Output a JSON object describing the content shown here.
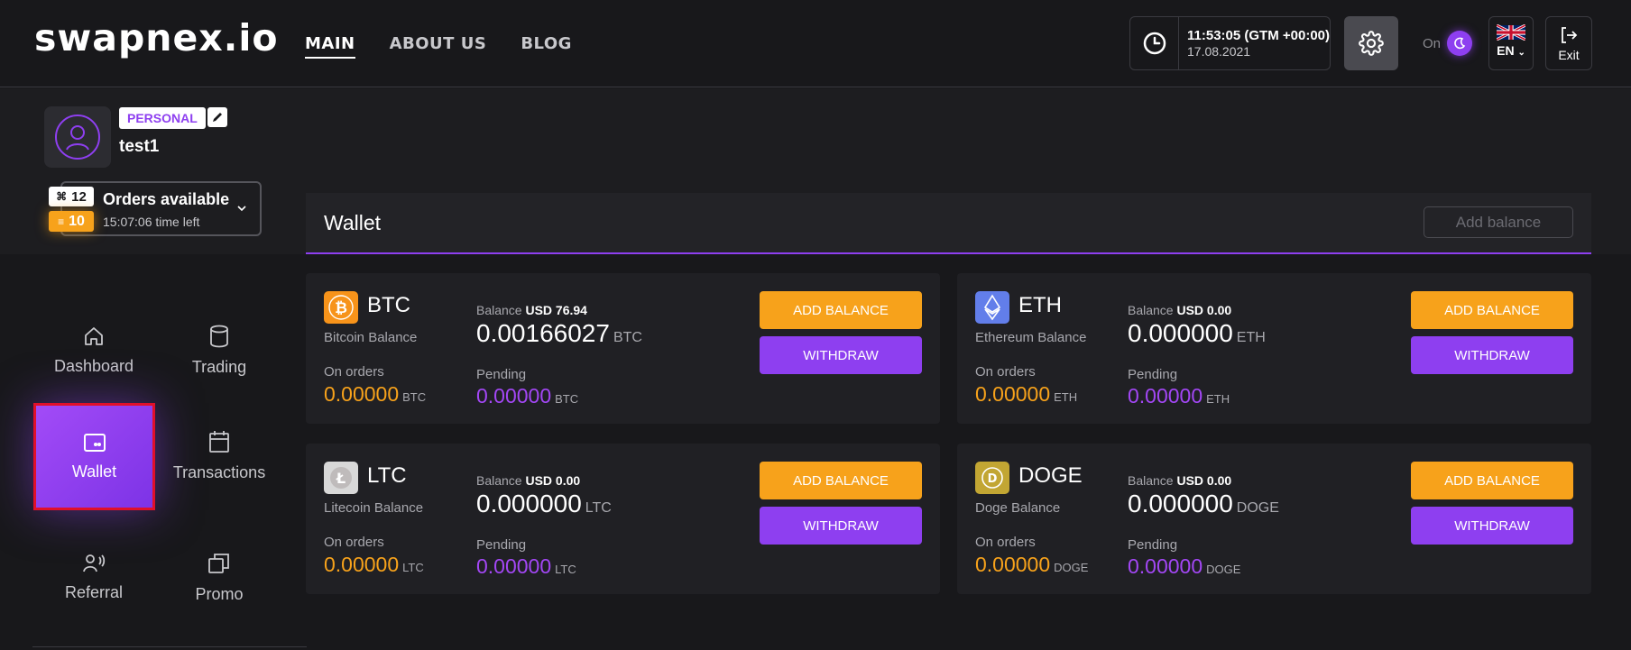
{
  "header": {
    "logo": "swapnex.io",
    "nav": [
      "MAIN",
      "ABOUT US",
      "BLOG"
    ],
    "clock": {
      "time": "11:53:05",
      "zone": "(GTM +00:00)",
      "date": "17.08.2021"
    },
    "theme_label": "On",
    "lang": "EN",
    "exit_label": "Exit"
  },
  "profile": {
    "badge": "PERSONAL",
    "username": "test1",
    "orders_badge_count": "12",
    "orders_badge_orange": "10",
    "orders_title": "Orders available",
    "orders_time": "15:07:06 time left"
  },
  "sidebar": [
    {
      "label": "Dashboard",
      "icon": "home-icon",
      "active": false
    },
    {
      "label": "Trading",
      "icon": "database-icon",
      "active": false
    },
    {
      "label": "Wallet",
      "icon": "wallet-icon",
      "active": true
    },
    {
      "label": "Transactions",
      "icon": "calendar-icon",
      "active": false
    },
    {
      "label": "Referral",
      "icon": "referral-icon",
      "active": false
    },
    {
      "label": "Promo",
      "icon": "promo-icon",
      "active": false
    }
  ],
  "wallet": {
    "title": "Wallet",
    "add_balance_top": "Add balance",
    "balance_label": "Balance",
    "on_orders_label": "On orders",
    "pending_label": "Pending",
    "add_btn": "ADD BALANCE",
    "withdraw_btn": "WITHDRAW",
    "coins": [
      {
        "symbol": "BTC",
        "name": "Bitcoin Balance",
        "usd": "USD 76.94",
        "balance": "0.00166027",
        "on_orders": "0.00000",
        "pending": "0.00000",
        "color": "#f7931a"
      },
      {
        "symbol": "ETH",
        "name": "Ethereum Balance",
        "usd": "USD 0.00",
        "balance": "0.000000",
        "on_orders": "0.00000",
        "pending": "0.00000",
        "color": "#627eea"
      },
      {
        "symbol": "LTC",
        "name": "Litecoin Balance",
        "usd": "USD 0.00",
        "balance": "0.000000",
        "on_orders": "0.00000",
        "pending": "0.00000",
        "color": "#bfbbbb"
      },
      {
        "symbol": "DOGE",
        "name": "Doge Balance",
        "usd": "USD 0.00",
        "balance": "0.000000",
        "on_orders": "0.00000",
        "pending": "0.00000",
        "color": "#c2a633"
      }
    ]
  },
  "colors": {
    "accent": "#8e3ff0",
    "orange": "#f7a21b",
    "background": "#18181b"
  }
}
